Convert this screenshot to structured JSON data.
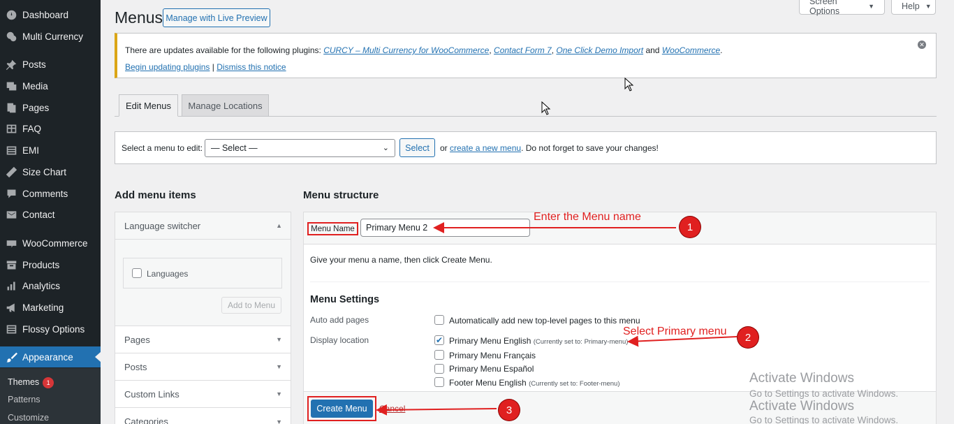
{
  "sidebar": {
    "items": [
      {
        "label": "Dashboard",
        "icon": "dashboard-icon"
      },
      {
        "label": "Multi Currency",
        "icon": "currency-icon"
      },
      {
        "label": "Posts",
        "icon": "pin-icon"
      },
      {
        "label": "Media",
        "icon": "media-icon"
      },
      {
        "label": "Pages",
        "icon": "pages-icon"
      },
      {
        "label": "FAQ",
        "icon": "faq-icon"
      },
      {
        "label": "EMI",
        "icon": "emi-icon"
      },
      {
        "label": "Size Chart",
        "icon": "ruler-icon"
      },
      {
        "label": "Comments",
        "icon": "comment-icon"
      },
      {
        "label": "Contact",
        "icon": "mail-icon"
      },
      {
        "label": "WooCommerce",
        "icon": "woo-icon"
      },
      {
        "label": "Products",
        "icon": "archive-icon"
      },
      {
        "label": "Analytics",
        "icon": "chart-icon"
      },
      {
        "label": "Marketing",
        "icon": "megaphone-icon"
      },
      {
        "label": "Flossy Options",
        "icon": "list-icon"
      },
      {
        "label": "Appearance",
        "icon": "brush-icon"
      }
    ],
    "submenu": {
      "themes": "Themes",
      "themes_badge": "1",
      "patterns": "Patterns",
      "customize": "Customize"
    }
  },
  "header": {
    "title": "Menus",
    "live_preview": "Manage with Live Preview",
    "screen_options": "Screen Options",
    "help": "Help"
  },
  "notice": {
    "text_before": "There are updates available for the following plugins: ",
    "plugin1": "CURCY – Multi Currency for WooCommerce",
    "comma1": ", ",
    "plugin2": "Contact Form 7",
    "comma2": ", ",
    "plugin3": "One Click Demo Import",
    "and": " and ",
    "plugin4": "WooCommerce",
    "period": ".",
    "begin": "Begin updating plugins",
    "sep": " | ",
    "dismiss": "Dismiss this notice"
  },
  "tabs": {
    "edit": "Edit Menus",
    "manage": "Manage Locations"
  },
  "select_menu": {
    "label": "Select a menu to edit:",
    "value": "— Select —",
    "button": "Select",
    "or": "or ",
    "create_link": "create a new menu",
    "after": ". Do not forget to save your changes!"
  },
  "add_items": {
    "title": "Add menu items",
    "language_switcher": "Language switcher",
    "languages": "Languages",
    "add_button": "Add to Menu",
    "pages": "Pages",
    "posts": "Posts",
    "custom_links": "Custom Links",
    "categories": "Categories"
  },
  "structure": {
    "title": "Menu structure",
    "name_label": "Menu Name",
    "name_value": "Primary Menu 2",
    "hint": "Give your menu a name, then click Create Menu.",
    "settings_title": "Menu Settings",
    "auto_add_label": "Auto add pages",
    "auto_add_text": "Automatically add new top-level pages to this menu",
    "display_location": "Display location",
    "locations": [
      {
        "label": "Primary Menu English",
        "note": "(Currently set to: Primary-menu)",
        "checked": true
      },
      {
        "label": "Primary Menu Français",
        "note": "",
        "checked": false
      },
      {
        "label": "Primary Menu Español",
        "note": "",
        "checked": false
      },
      {
        "label": "Footer Menu English",
        "note": "(Currently set to: Footer-menu)",
        "checked": false
      }
    ],
    "create_button": "Create Menu",
    "cancel": "Cancel"
  },
  "annotations": {
    "a1": "Enter the Menu name",
    "n1": "1",
    "a2": "Select Primary menu",
    "n2": "2",
    "n3": "3",
    "color": "#e02020"
  },
  "watermark": {
    "line1": "Activate Windows",
    "line2": "Go to Settings to activate Windows."
  },
  "colors": {
    "sidebar_bg": "#1d2327",
    "accent": "#2271b1",
    "notice_border": "#dba617"
  }
}
